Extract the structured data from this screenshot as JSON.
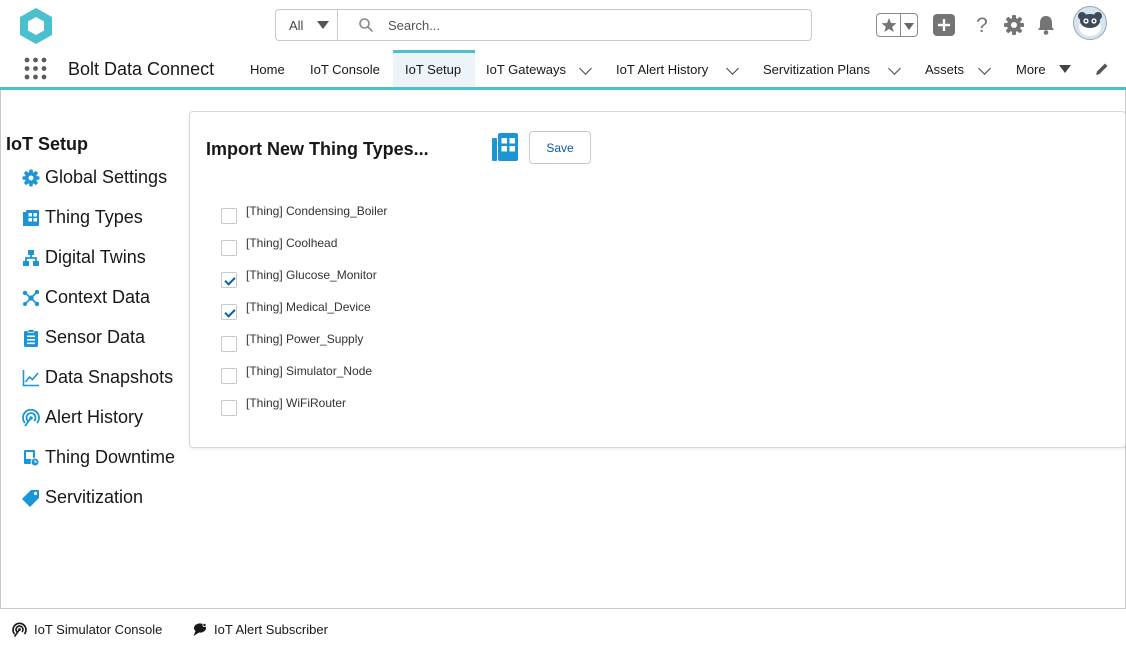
{
  "header": {
    "search": {
      "scope": "All",
      "placeholder": "Search..."
    }
  },
  "nav": {
    "app_name": "Bolt Data Connect",
    "items": [
      {
        "label": "Home"
      },
      {
        "label": "IoT Console"
      },
      {
        "label": "IoT Setup",
        "active": true
      },
      {
        "label": "IoT Gateways"
      },
      {
        "label": "IoT Alert History"
      },
      {
        "label": "Servitization Plans"
      },
      {
        "label": "Assets"
      },
      {
        "label": "More"
      }
    ]
  },
  "sidebar": {
    "title": "IoT Setup",
    "items": [
      {
        "label": "Global Settings",
        "icon": "gear-icon"
      },
      {
        "label": "Thing Types",
        "icon": "thing-types-icon"
      },
      {
        "label": "Digital Twins",
        "icon": "hierarchy-icon"
      },
      {
        "label": "Context Data",
        "icon": "network-icon"
      },
      {
        "label": "Sensor Data",
        "icon": "clipboard-icon"
      },
      {
        "label": "Data Snapshots",
        "icon": "line-chart-icon"
      },
      {
        "label": "Alert History",
        "icon": "signal-icon"
      },
      {
        "label": "Thing Downtime",
        "icon": "device-clock-icon"
      },
      {
        "label": "Servitization",
        "icon": "tag-icon"
      }
    ]
  },
  "card": {
    "title": "Import New Thing Types...",
    "save_label": "Save",
    "options": [
      {
        "label": "[Thing] Condensing_Boiler",
        "checked": false
      },
      {
        "label": "[Thing] Coolhead",
        "checked": false
      },
      {
        "label": "[Thing] Glucose_Monitor",
        "checked": true
      },
      {
        "label": "[Thing] Medical_Device",
        "checked": true
      },
      {
        "label": "[Thing] Power_Supply",
        "checked": false
      },
      {
        "label": "[Thing] Simulator_Node",
        "checked": false
      },
      {
        "label": "[Thing] WiFiRouter",
        "checked": false
      }
    ]
  },
  "footer": {
    "items": [
      {
        "label": "IoT Simulator Console",
        "icon": "signal-icon"
      },
      {
        "label": "IoT Alert Subscriber",
        "icon": "chat-icon"
      }
    ]
  },
  "colors": {
    "accent": "#4bc1d0",
    "icon_blue": "#1b96d4",
    "link_blue": "#0b5cab",
    "header_icon_gray": "#747474"
  }
}
